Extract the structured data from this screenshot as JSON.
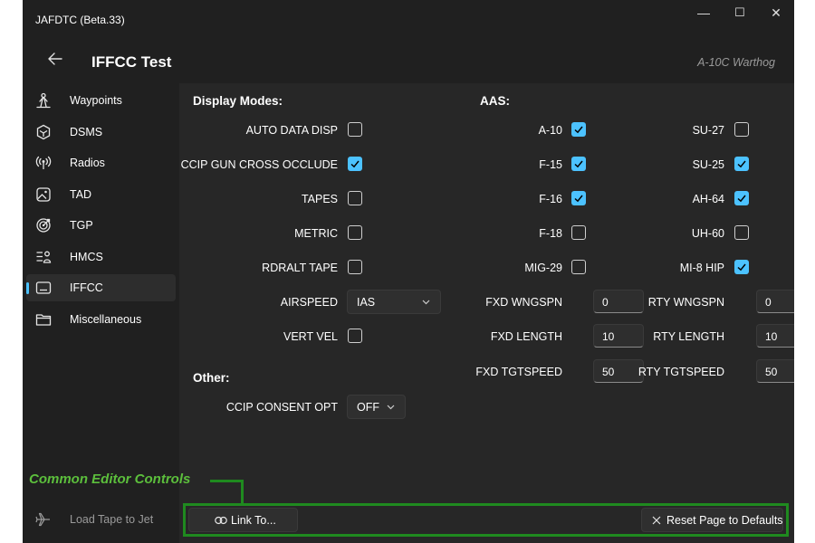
{
  "window": {
    "title": "JAFDTC (Beta.33)",
    "controls": {
      "minimize": "—",
      "maximize": "☐",
      "close": "✕"
    }
  },
  "header": {
    "page_title": "IFFCC Test",
    "airframe": "A-10C Warthog"
  },
  "sidebar": {
    "items": [
      {
        "label": "Waypoints",
        "icon": "person-waypoint-icon",
        "selected": false
      },
      {
        "label": "DSMS",
        "icon": "dsms-icon",
        "selected": false
      },
      {
        "label": "Radios",
        "icon": "radio-antenna-icon",
        "selected": false
      },
      {
        "label": "TAD",
        "icon": "tad-image-icon",
        "selected": false
      },
      {
        "label": "TGP",
        "icon": "target-icon",
        "selected": false
      },
      {
        "label": "HMCS",
        "icon": "hmcs-icon",
        "selected": false
      },
      {
        "label": "IFFCC",
        "icon": "iffcc-screen-icon",
        "selected": true
      },
      {
        "label": "Miscellaneous",
        "icon": "folder-icon",
        "selected": false
      }
    ],
    "bottom_item": {
      "label": "Load Tape to Jet",
      "icon": "airplane-icon"
    }
  },
  "display_modes": {
    "heading": "Display Modes:",
    "auto_data_disp": {
      "label": "AUTO DATA DISP",
      "checked": false
    },
    "ccip_gun_cross_occlude": {
      "label": "CCIP GUN CROSS OCCLUDE",
      "checked": true
    },
    "tapes": {
      "label": "TAPES",
      "checked": false
    },
    "metric": {
      "label": "METRIC",
      "checked": false
    },
    "rdralt_tape": {
      "label": "RDRALT TAPE",
      "checked": false
    },
    "airspeed": {
      "label": "AIRSPEED",
      "value": "IAS"
    },
    "vert_vel": {
      "label": "VERT VEL",
      "checked": false
    }
  },
  "other": {
    "heading": "Other:",
    "ccip_consent_opt": {
      "label": "CCIP CONSENT OPT",
      "value": "OFF"
    }
  },
  "aas": {
    "heading": "AAS:",
    "a10": {
      "label": "A-10",
      "checked": true
    },
    "f15": {
      "label": "F-15",
      "checked": true
    },
    "f16": {
      "label": "F-16",
      "checked": true
    },
    "f18": {
      "label": "F-18",
      "checked": false
    },
    "mig29": {
      "label": "MIG-29",
      "checked": false
    },
    "su27": {
      "label": "SU-27",
      "checked": false
    },
    "su25": {
      "label": "SU-25",
      "checked": true
    },
    "ah64": {
      "label": "AH-64",
      "checked": true
    },
    "uh60": {
      "label": "UH-60",
      "checked": false
    },
    "mi8hip": {
      "label": "MI-8 HIP",
      "checked": true
    },
    "fxd_wngspn": {
      "label": "FXD WNGSPN",
      "value": "0"
    },
    "fxd_length": {
      "label": "FXD LENGTH",
      "value": "10"
    },
    "fxd_tgtspeed": {
      "label": "FXD TGTSPEED",
      "value": "50"
    },
    "rty_wngspn": {
      "label": "RTY WNGSPN",
      "value": "0"
    },
    "rty_length": {
      "label": "RTY LENGTH",
      "value": "10"
    },
    "rty_tgtspeed": {
      "label": "RTY TGTSPEED",
      "value": "50"
    }
  },
  "footer": {
    "link_to_label": "Link To...",
    "reset_label": "Reset Page to Defaults"
  },
  "annotation": {
    "label": "Common Editor Controls",
    "color": "#1f8a1f"
  },
  "colors": {
    "accent": "#4cc2ff",
    "window_bg": "#202020",
    "content_bg": "#272727"
  }
}
